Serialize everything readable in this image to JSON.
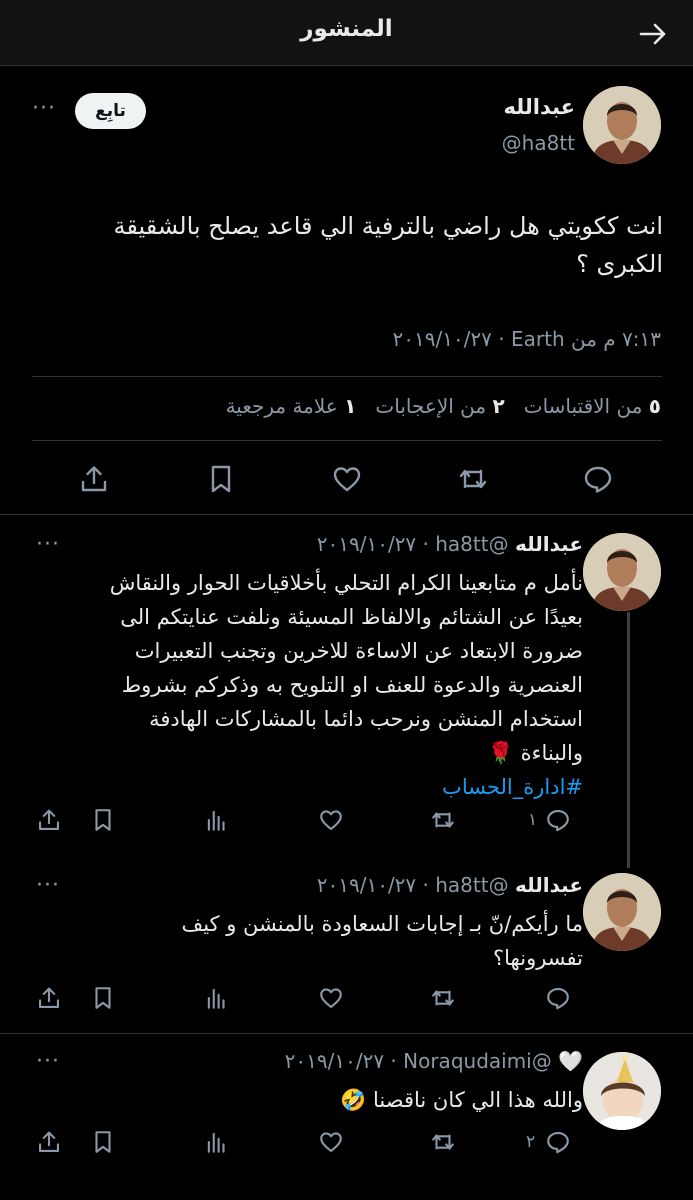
{
  "header": {
    "title": "المنشور",
    "back_icon": "arrow-right-icon"
  },
  "main_tweet": {
    "author_name": "عبدالله",
    "author_handle": "@ha8tt",
    "follow_label": "تابِع",
    "more_label": "···",
    "text_line1": "انت ككويتي هل راضي بالترفية الي قاعد يصلح بالشقيقة",
    "text_line2": "الكبرى ؟",
    "meta": "٧:١٣ م من Earth · ٢٠١٩/١٠/٢٧",
    "stats": {
      "retweets_count": "٥",
      "retweets_label": "من الاقتباسات",
      "likes_count": "٢",
      "likes_label": "من الإعجابات",
      "bookmarks_count": "١",
      "bookmarks_label": "علامة مرجعية"
    }
  },
  "replies": [
    {
      "name": "عبدالله",
      "meta": "@ha8tt · ٢٠١٩/١٠/٢٧",
      "lines": [
        "نأمل م متابعينا الكرام التحلي بأخلاقيات الحوار والنقاش",
        "بعيدًا عن الشتائم والالفاظ المسيئة ونلفت عنايتكم الى",
        "ضرورة الابتعاد عن الاساءة للاخرين وتجنب التعبيرات",
        "العنصرية والدعوة للعنف او التلويح به وذكركم بشروط",
        "استخدام المنشن ونرحب دائما بالمشاركات الهادفة",
        "والبناءة 🌹"
      ],
      "hashtag": "#ادارة_الحساب",
      "reply_count": "١"
    },
    {
      "name": "عبدالله",
      "meta": "@ha8tt · ٢٠١٩/١٠/٢٧",
      "lines": [
        "ما رأيكم/نّ بـ إجابات السعاودة بالمنشن و كيف",
        "تفسرونها؟"
      ]
    },
    {
      "name": "🤍",
      "meta": "@Noraqudaimi · ٢٠١٩/١٠/٢٧",
      "lines": [
        "والله هذا الي كان ناقصنا 🤣"
      ],
      "reply_count": "٢"
    }
  ],
  "colors": {
    "background": "#000000",
    "text": "#e7e9ea",
    "muted": "#8b98a5",
    "link": "#1d9bf0",
    "divider": "#2f3336"
  }
}
